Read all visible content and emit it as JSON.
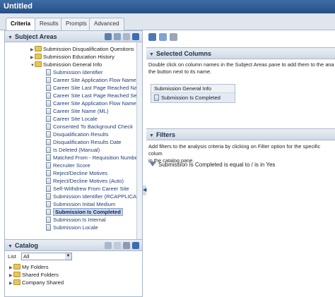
{
  "window": {
    "title": "Untitled"
  },
  "tabs": [
    {
      "label": "Criteria",
      "active": true
    },
    {
      "label": "Results",
      "active": false
    },
    {
      "label": "Prompts",
      "active": false
    },
    {
      "label": "Advanced",
      "active": false
    }
  ],
  "subject_areas": {
    "header": "Subject Areas",
    "folders": [
      {
        "label": "Submission Disqualification Questions",
        "expanded": false
      },
      {
        "label": "Submission Education History",
        "expanded": false
      },
      {
        "label": "Submission General Info",
        "expanded": true
      }
    ],
    "columns": [
      "Submission Identifier",
      "Career Site Application Flow Name (BL)",
      "Career Site Last Page Reached Name (BL)",
      "Career Site Last Page Reached Sequence",
      "Career Site Application Flow Name (ML)",
      "Career Site Name (ML)",
      "Career Site Locale",
      "Consented To Background Check",
      "Disqualification Results",
      "Disqualification Results Date",
      "Is Deleted (Manual)",
      "Matched From - Requisition Number",
      "Recruiter Score",
      "Reject/Decline Motives",
      "Reject/Decline Motives (Auto)",
      "Self-Withdrew From Career Site",
      "Submission Identifier (RCAPPLICATION",
      "Submission Initial Medium",
      "Submission Is Completed",
      "Submission Is Internal",
      "Submission Locale"
    ],
    "selected_column": "Submission Is Completed"
  },
  "catalog": {
    "header": "Catalog",
    "list_label": "List",
    "list_value": "All",
    "folders": [
      "My Folders",
      "Shared Folders",
      "Company Shared"
    ]
  },
  "selected_columns": {
    "header": "Selected Columns",
    "hint": "Double click on column names in the Subject Areas pane to add them to the analysis. You can also click the button next to its name.",
    "hint_line1": "Double click on column names in the Subject Areas pane to add them to the ana",
    "hint_line2": "the button next to its name.",
    "group": "Submission General Info",
    "items": [
      "Submission Is Completed"
    ]
  },
  "filters": {
    "header": "Filters",
    "hint_line1": "Add filters to the analysis criteria by clicking on Filter option for the specific colum",
    "hint_line2": "in the catalog pane.",
    "items": [
      "Submission Is Completed is equal to / is in  Yes"
    ]
  },
  "colors": {
    "title_bar": "#2f5c96",
    "accent": "#4b6ea8",
    "folder": "#e7c65a"
  }
}
